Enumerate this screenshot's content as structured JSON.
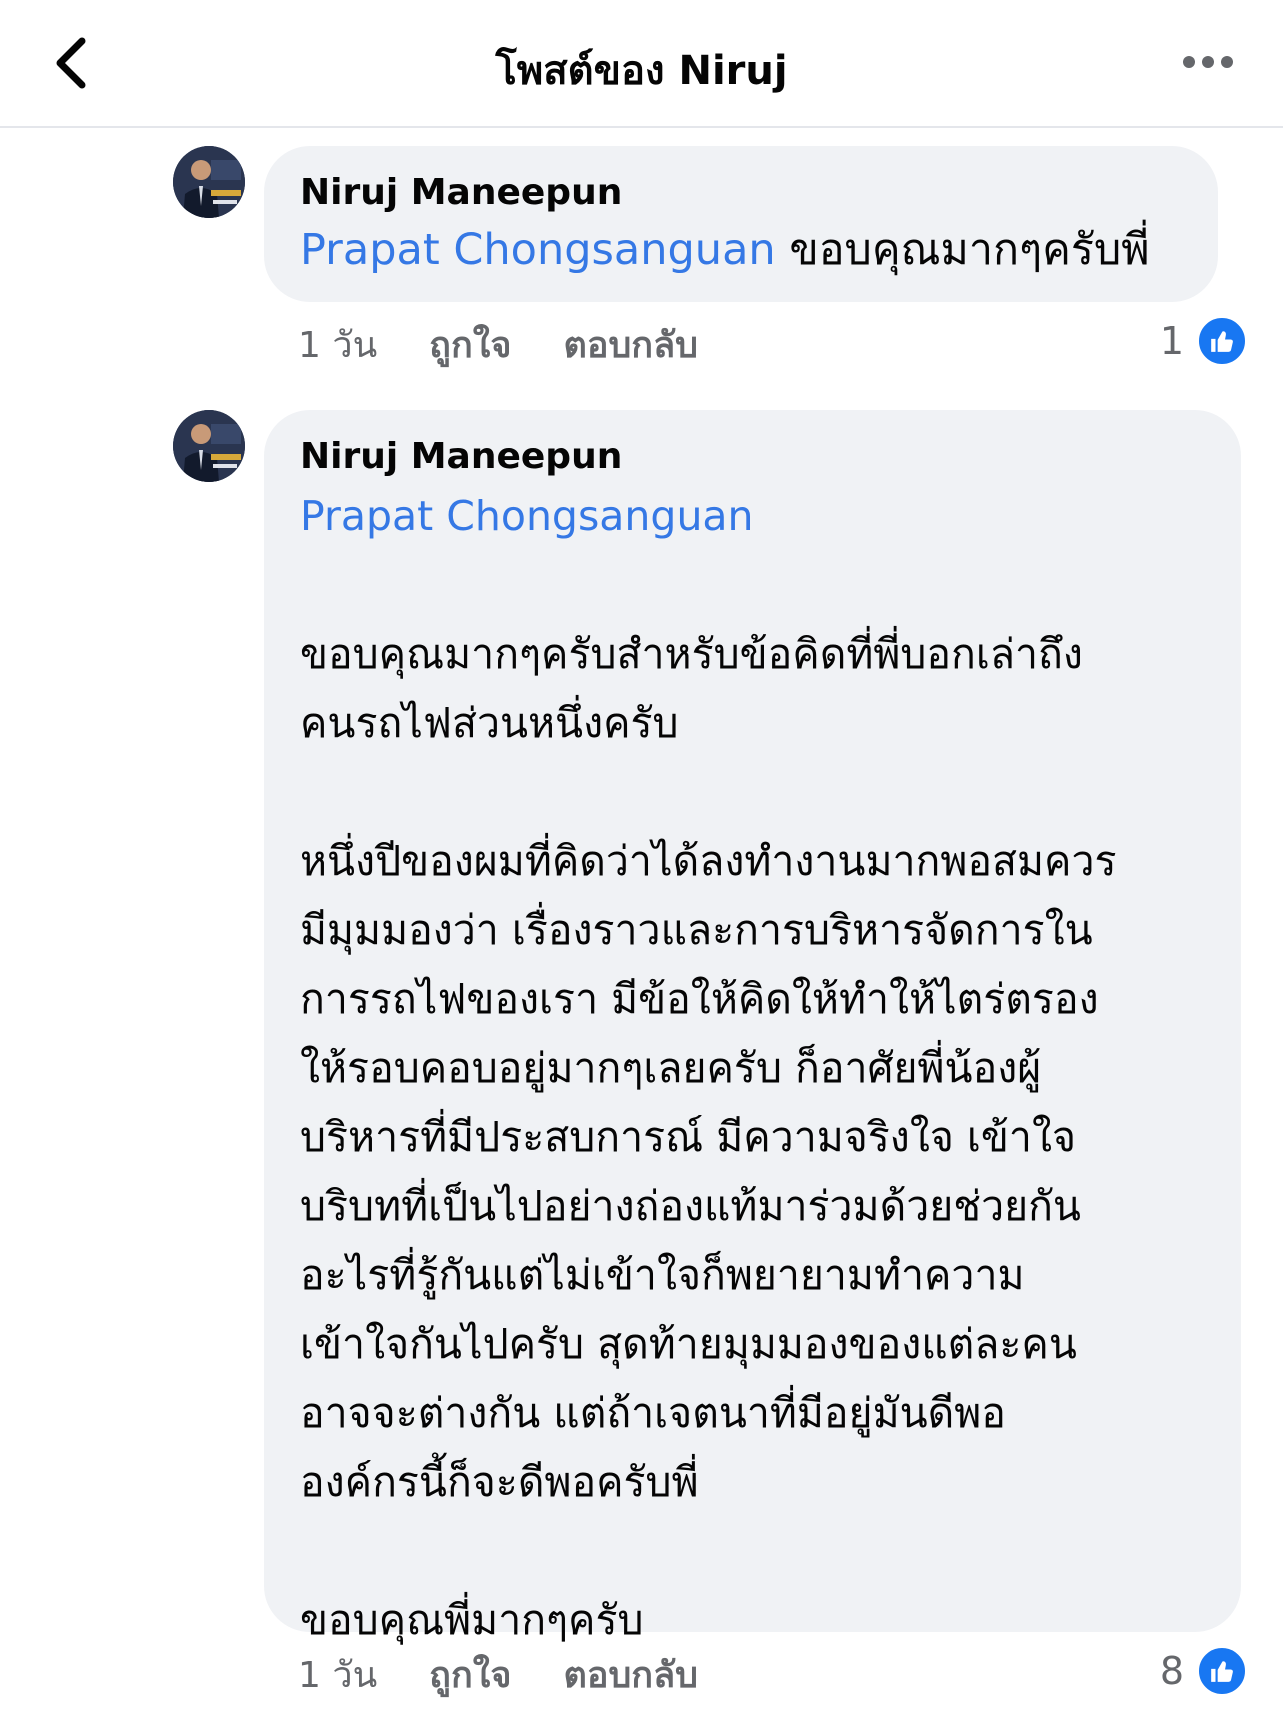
{
  "header": {
    "title": "โพสต์ของ Niruj",
    "back_icon": "chevron-left-icon",
    "more_icon": "more-horizontal-icon"
  },
  "comments": [
    {
      "author": "Niruj Maneepun",
      "mention": "Prapat Chongsanguan",
      "text": " ขอบคุณมากๆครับพี่",
      "time": "1 วัน",
      "like_label": "ถูกใจ",
      "reply_label": "ตอบกลับ",
      "reaction_count": "1"
    },
    {
      "author": "Niruj Maneepun",
      "mention": "Prapat Chongsanguan",
      "text": "\n\nขอบคุณมากๆครับสำหรับข้อคิดที่พี่บอกเล่าถึง\nคนรถไฟส่วนหนึ่งครับ\n\nหนึ่งปีของผมที่คิดว่าได้ลงทำงานมากพอสมควร\nมีมุมมองว่า เรื่องราวและการบริหารจัดการใน\nการรถไฟของเรา มีข้อให้คิดให้ทำให้ไตร่ตรอง\nให้รอบคอบอยู่มากๆเลยครับ ก็อาศัยพี่น้องผู้\nบริหารที่มีประสบการณ์ มีความจริงใจ เข้าใจ\nบริบทที่เป็นไปอย่างถ่องแท้มาร่วมด้วยช่วยกัน\nอะไรที่รู้กันแต่ไม่เข้าใจก็พยายามทำความ\nเข้าใจกันไปครับ สุดท้ายมุมมองของแต่ละคน\nอาจจะต่างกัน แต่ถ้าเจตนาที่มีอยู่มันดีพอ\nองค์กรนี้ก็จะดีพอครับพี่\n\nขอบคุณพี่มากๆครับ",
      "time": "1 วัน",
      "like_label": "ถูกใจ",
      "reply_label": "ตอบกลับ",
      "reaction_count": "8"
    }
  ],
  "colors": {
    "mention": "#3578e5",
    "bubble": "#f0f2f5",
    "like_badge": "#1877f2",
    "meta_text": "#65676b"
  }
}
